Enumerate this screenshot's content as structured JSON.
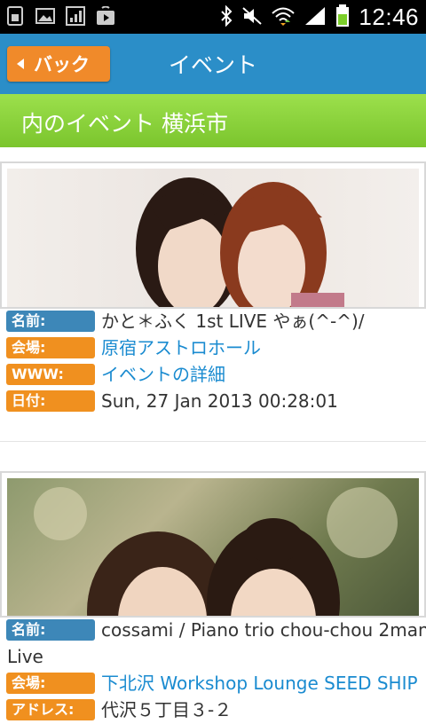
{
  "status_bar": {
    "time": "12:46",
    "icons": [
      "sim-icon",
      "gallery-icon",
      "signal-app-icon",
      "play-store-icon",
      "bluetooth-icon",
      "mute-icon",
      "wifi-icon",
      "cell-signal-icon",
      "battery-icon"
    ]
  },
  "action_bar": {
    "back_label": "バック",
    "title": "イベント"
  },
  "section_header": "内のイベント 横浜市",
  "colors": {
    "action_bar": "#2b8ec8",
    "back_button": "#f08a2a",
    "header_green": "#8ad43a",
    "badge_blue": "#3d87b8",
    "badge_orange": "#f0901f",
    "link": "#1a8bd0"
  },
  "events": [
    {
      "name_label": "名前:",
      "name": "かと＊ふく 1st LIVE やぁ(^-^)/",
      "venue_label": "会場:",
      "venue": "原宿アストロホール",
      "www_label": "WWW:",
      "www": "イベントの詳細",
      "date_label": "日付:",
      "date": "Sun, 27 Jan 2013 00:28:01"
    },
    {
      "name_label": "名前:",
      "name_line1": "cossami / Piano trio chou-chou 2man",
      "name_line2": "Live",
      "venue_label": "会場:",
      "venue": "下北沢 Workshop Lounge SEED SHIP",
      "address_label": "アドレス:",
      "address": "代沢５丁目３-２"
    }
  ]
}
